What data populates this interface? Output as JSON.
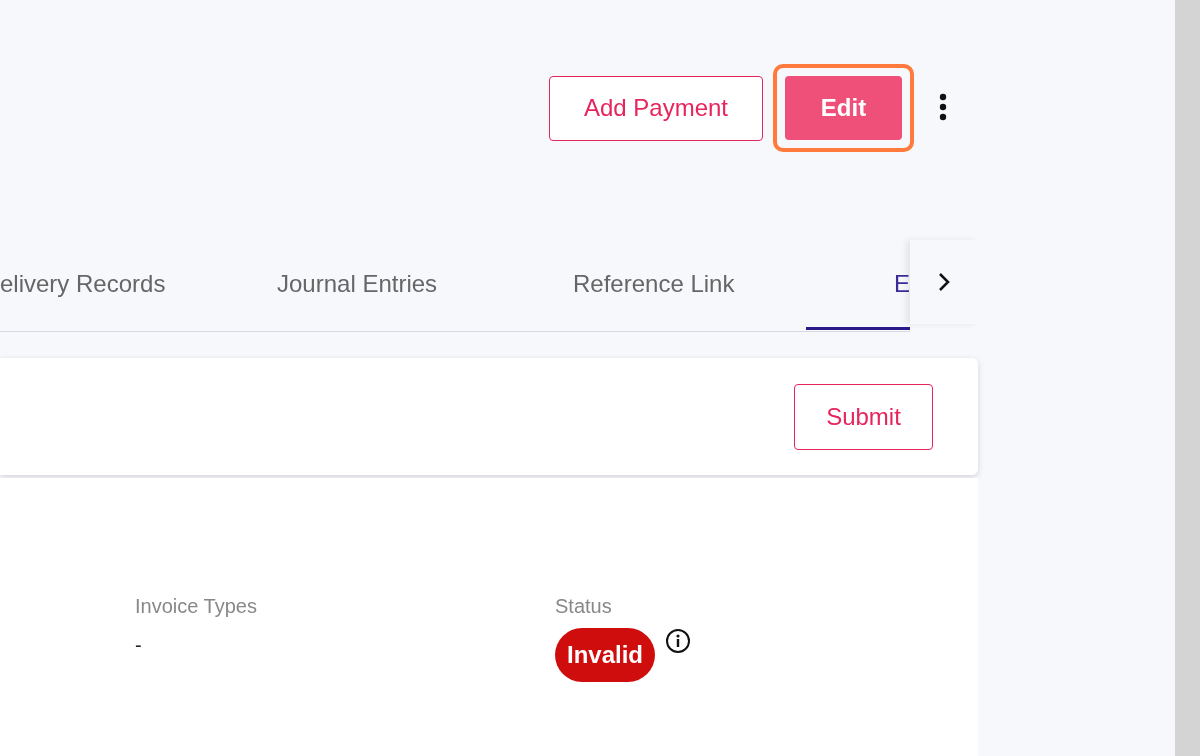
{
  "header": {
    "buttons": [
      {
        "label": "Add Payment",
        "kind": "outline"
      },
      {
        "label": "Edit",
        "kind": "filled",
        "highlighted": true
      }
    ]
  },
  "tabs": [
    {
      "label": "elivery Records",
      "selected": false
    },
    {
      "label": "Journal Entries",
      "selected": false
    },
    {
      "label": "Reference Link",
      "selected": false
    },
    {
      "label": "E",
      "selected": true
    }
  ],
  "action_card": {
    "button": "Submit"
  },
  "details": [
    {
      "label": "Invoice Types",
      "value": "-",
      "kind": "text"
    },
    {
      "label": "Status",
      "value": "Invalid",
      "kind": "badge",
      "color": "#d00d0d"
    }
  ]
}
